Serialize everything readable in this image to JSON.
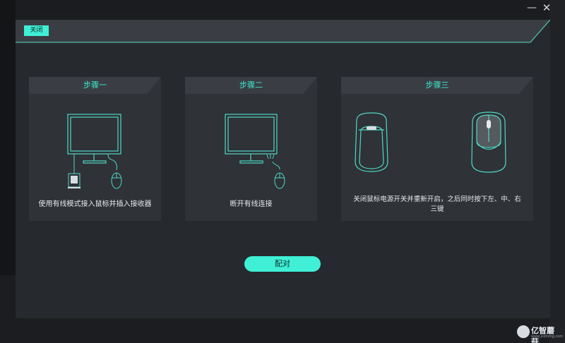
{
  "window": {
    "minimize_glyph": "—",
    "close_glyph": "✕"
  },
  "dialog": {
    "close_label": "关闭"
  },
  "steps": [
    {
      "title": "步骤一",
      "text": "使用有线模式接入鼠标并插入接收器"
    },
    {
      "title": "步骤二",
      "text": "断开有线连接"
    },
    {
      "title": "步骤三",
      "text_line1": "关闭鼠标电源开关并重新开启，之后同时按下左、中、右",
      "text_line2": "三键"
    }
  ],
  "pair_button": {
    "label": "配对"
  },
  "watermark": {
    "name": "亿智蘑菇",
    "url": "www.yizhimg.com"
  },
  "colors": {
    "accent": "#3ff0d6",
    "panel": "#2f3237",
    "dialog": "#26292d",
    "line": "#4fd8c4"
  },
  "icons": [
    "monitor-icon",
    "usb-receiver-icon",
    "mouse-icon",
    "mouse-bottom-icon",
    "mouse-top-icon",
    "minimize-icon",
    "close-icon"
  ]
}
